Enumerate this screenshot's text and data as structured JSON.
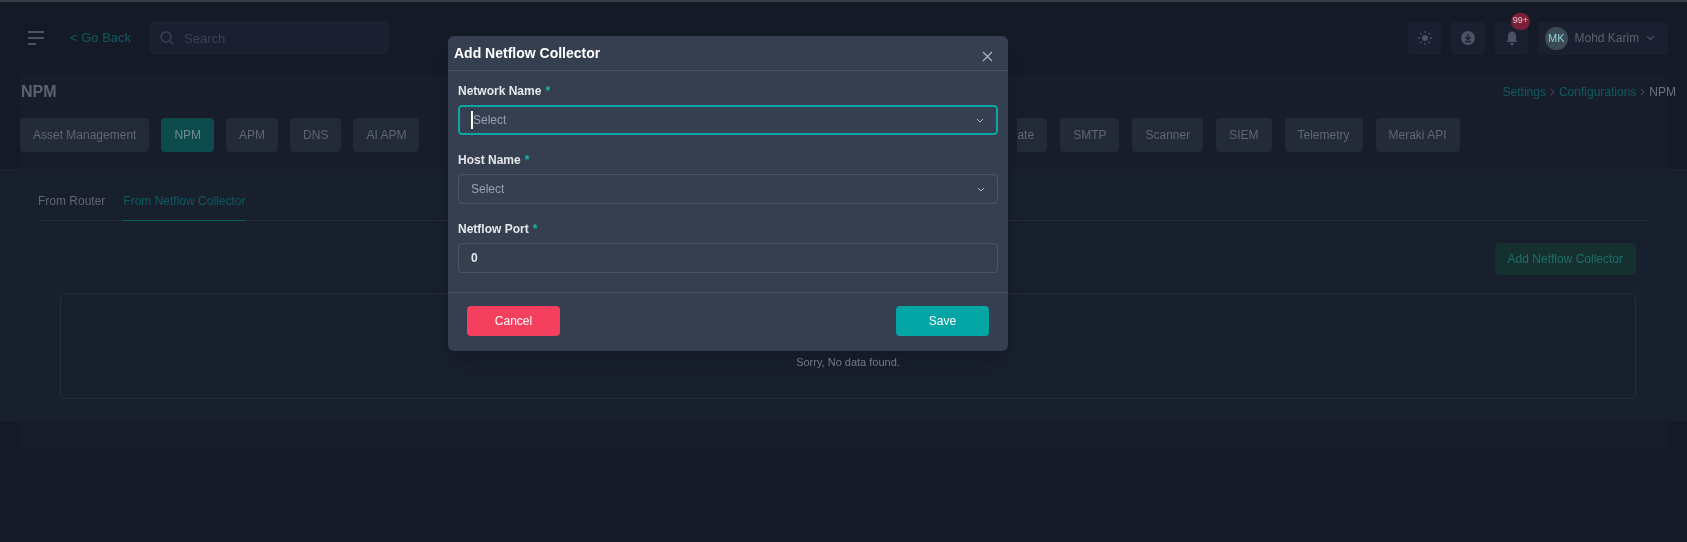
{
  "topbar": {
    "back_link": "< Go Back",
    "search": {
      "placeholder": "Search"
    },
    "notification_badge": "99+",
    "user": {
      "initials": "MK",
      "name": "Mohd Karim"
    }
  },
  "page": {
    "title": "NPM",
    "breadcrumb": [
      "Settings",
      "Configurations",
      "NPM"
    ]
  },
  "settings_tabs": [
    {
      "label": "Asset Management",
      "selected": false
    },
    {
      "label": "NPM",
      "selected": true
    },
    {
      "label": "APM",
      "selected": false
    },
    {
      "label": "DNS",
      "selected": false
    },
    {
      "label": "AI APM",
      "selected": false
    }
  ],
  "settings_tabs_right": [
    {
      "label": "ate",
      "selected": false
    },
    {
      "label": "SMTP",
      "selected": false
    },
    {
      "label": "Scanner",
      "selected": false
    },
    {
      "label": "SIEM",
      "selected": false
    },
    {
      "label": "Telemetry",
      "selected": false
    },
    {
      "label": "Meraki API",
      "selected": false
    }
  ],
  "source_tabs": [
    {
      "label": "From Router",
      "selected": false
    },
    {
      "label": "From Netflow Collector",
      "selected": true
    }
  ],
  "add_button": "Add Netflow Collector",
  "empty_message": "Sorry, No data found.",
  "dialog": {
    "title": "Add Netflow Collector",
    "fields": [
      {
        "kind": "select",
        "label": "Network Name",
        "required_mark": "*",
        "placeholder": "Select",
        "focused": true
      },
      {
        "kind": "select",
        "label": "Host Name",
        "required_mark": "*",
        "placeholder": "Select",
        "focused": false
      },
      {
        "kind": "input",
        "label": "Netflow Port",
        "required_mark": "*",
        "value": "0",
        "focused": false
      }
    ],
    "cancel": "Cancel",
    "save": "Save"
  }
}
